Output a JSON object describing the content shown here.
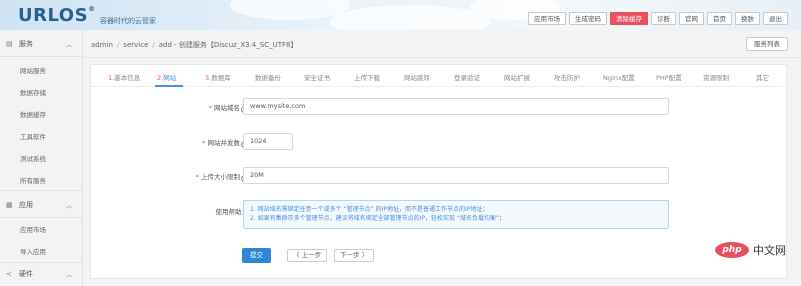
{
  "header": {
    "logo": "URLOS",
    "logo_reg": "®",
    "slogan": "容器时代的云管家",
    "nav": [
      {
        "label": "应用市场",
        "active": false
      },
      {
        "label": "生成密码",
        "active": false
      },
      {
        "label": "清除缓存",
        "active": true
      },
      {
        "label": "诊断",
        "active": false
      },
      {
        "label": "官网",
        "active": false
      },
      {
        "label": "首页",
        "active": false
      },
      {
        "label": "换肤",
        "active": false
      },
      {
        "label": "退出",
        "active": false
      }
    ]
  },
  "sidebar": {
    "groups": [
      {
        "icon": "server-icon",
        "label": "服务",
        "items": [
          "网站服务",
          "数据存储",
          "数据缓存",
          "工具软件",
          "测试系统",
          "所有服务"
        ]
      },
      {
        "icon": "grid-icon",
        "label": "应用",
        "items": [
          "应用市场",
          "导入应用"
        ]
      },
      {
        "icon": "share-icon",
        "label": "硬件",
        "items": []
      }
    ]
  },
  "breadcrumb": {
    "parts": [
      "admin",
      "service",
      "add - 创建服务【Discuz_X3.4_SC_UTF8】"
    ],
    "list_button": "服务列表"
  },
  "tabs": [
    {
      "num": "1.",
      "label": "基本信息",
      "active": false
    },
    {
      "num": "2.",
      "label": "网站",
      "active": true
    },
    {
      "num": "3.",
      "label": "数据库",
      "active": false
    },
    {
      "num": "",
      "label": "数据备份",
      "active": false
    },
    {
      "num": "",
      "label": "安全证书",
      "active": false
    },
    {
      "num": "",
      "label": "上传下载",
      "active": false
    },
    {
      "num": "",
      "label": "网站跳转",
      "active": false
    },
    {
      "num": "",
      "label": "登录验证",
      "active": false
    },
    {
      "num": "",
      "label": "网站扩展",
      "active": false
    },
    {
      "num": "",
      "label": "攻击防护",
      "active": false
    },
    {
      "num": "",
      "label": "Nginx配置",
      "active": false
    },
    {
      "num": "",
      "label": "PHP配置",
      "active": false
    },
    {
      "num": "",
      "label": "资源限制",
      "active": false
    },
    {
      "num": "",
      "label": "其它",
      "active": false
    }
  ],
  "form": {
    "domain_label": "网站域名",
    "domain_value": "www.mysite.com",
    "concurrency_label": "网站并发数",
    "concurrency_value": "1024",
    "upload_label": "上传大小限制",
    "upload_value": "20M",
    "help_label": "使用帮助：",
    "help_line1": "1. 网站域名需绑定任意一个或多个 “管理节点” 的IP地址，而不是普通工作节点的IP地址；",
    "help_line2": "2. 如果有集群存多个管理节点，建议将域名绑定全部管理节点的IP，轻松实现 “域名负载均衡”；",
    "submit": "提交",
    "prev": "上一步",
    "next": "下一步"
  },
  "watermark": {
    "badge": "php",
    "text": "中文网"
  },
  "colors": {
    "accent": "#4a90d9",
    "primary_button": "#2e86d8",
    "danger": "#e9505d",
    "logo": "#2b5f8e"
  }
}
